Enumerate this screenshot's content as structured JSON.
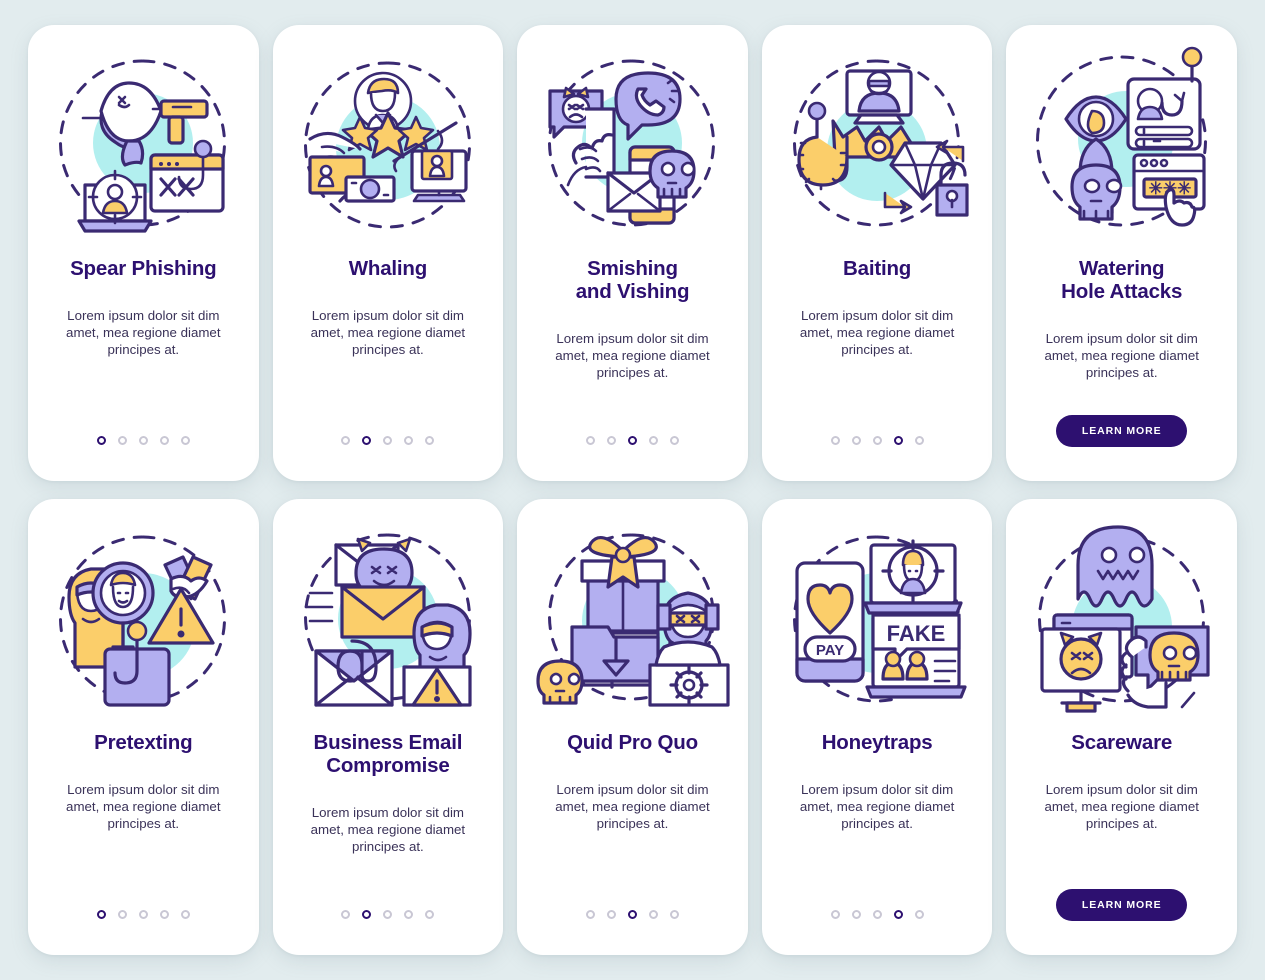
{
  "page": {
    "background_color": "#e2ecee",
    "card_background": "#ffffff",
    "title_color": "#2d1070",
    "body_color": "#3a3258",
    "accent_purple": "#b3aff0",
    "accent_yellow": "#fbce6a",
    "accent_cyan": "#b2efef",
    "outline_color": "#3a2a72",
    "dot_inactive_color": "#c9c7d4"
  },
  "common": {
    "description": "Lorem ipsum dolor sit dim amet, mea regione diamet principes at.",
    "learn_more_label": "LEARN MORE",
    "dot_count": 5
  },
  "cards": [
    {
      "id": "spear-phishing",
      "title": "Spear Phishing",
      "description": "Lorem ipsum dolor sit dim amet, mea regione diamet principes at.",
      "active_dot": 1,
      "has_button": false,
      "icon_name": "spear-phishing-illustration"
    },
    {
      "id": "whaling",
      "title": "Whaling",
      "description": "Lorem ipsum dolor sit dim amet, mea regione diamet principes at.",
      "active_dot": 2,
      "has_button": false,
      "icon_name": "whaling-illustration"
    },
    {
      "id": "smishing-and-vishing",
      "title": "Smishing\nand Vishing",
      "description": "Lorem ipsum dolor sit dim amet, mea regione diamet principes at.",
      "active_dot": 3,
      "has_button": false,
      "icon_name": "smishing-vishing-illustration"
    },
    {
      "id": "baiting",
      "title": "Baiting",
      "description": "Lorem ipsum dolor sit dim amet, mea regione diamet principes at.",
      "active_dot": 4,
      "has_button": false,
      "icon_name": "baiting-illustration"
    },
    {
      "id": "watering-hole-attacks",
      "title": "Watering\nHole Attacks",
      "description": "Lorem ipsum dolor sit dim amet, mea regione diamet principes at.",
      "active_dot": 0,
      "has_button": true,
      "button_label": "LEARN MORE",
      "icon_name": "watering-hole-illustration"
    },
    {
      "id": "pretexting",
      "title": "Pretexting",
      "description": "Lorem ipsum dolor sit dim amet, mea regione diamet principes at.",
      "active_dot": 1,
      "has_button": false,
      "icon_name": "pretexting-illustration"
    },
    {
      "id": "business-email-compromise",
      "title": "Business Email\nCompromise",
      "description": "Lorem ipsum dolor sit dim amet, mea regione diamet principes at.",
      "active_dot": 2,
      "has_button": false,
      "icon_name": "business-email-compromise-illustration"
    },
    {
      "id": "quid-pro-quo",
      "title": "Quid Pro Quo",
      "description": "Lorem ipsum dolor sit dim amet, mea regione diamet principes at.",
      "active_dot": 3,
      "has_button": false,
      "icon_name": "quid-pro-quo-illustration"
    },
    {
      "id": "honeytraps",
      "title": "Honeytraps",
      "description": "Lorem ipsum dolor sit dim amet, mea regione diamet principes at.",
      "active_dot": 4,
      "has_button": false,
      "icon_name": "honeytraps-illustration"
    },
    {
      "id": "scareware",
      "title": "Scareware",
      "description": "Lorem ipsum dolor sit dim amet, mea regione diamet principes at.",
      "active_dot": 0,
      "has_button": true,
      "button_label": "LEARN MORE",
      "icon_name": "scareware-illustration"
    }
  ],
  "illustration_text": {
    "spear_phishing_password_marks": "XXX",
    "watering_hole_password_marks": "* * *",
    "honeytraps_pay": "PAY",
    "honeytraps_fake": "FAKE"
  }
}
